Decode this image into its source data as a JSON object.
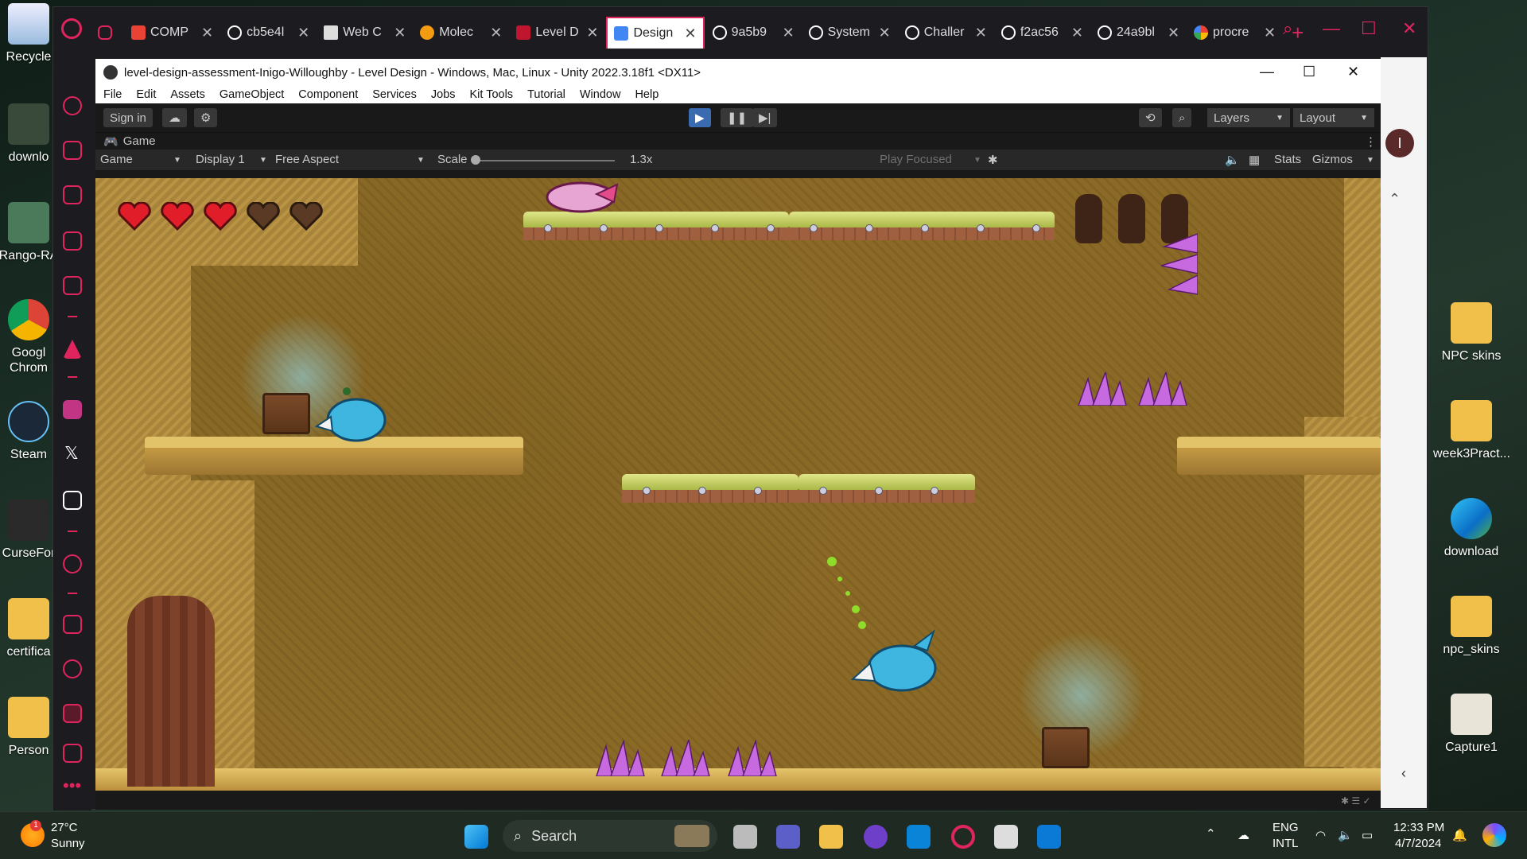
{
  "desktop": {
    "left_icons": [
      "Recycle",
      "downlo",
      "Rango-RA",
      "Googl\nChrom",
      "Steam",
      "CurseFor",
      "certifica",
      "Person"
    ],
    "right_icons": [
      "NPC skins",
      "week3Pract...",
      "download",
      "npc_skins",
      "Capture1"
    ]
  },
  "browser": {
    "tabs": [
      {
        "label": "",
        "icon": "gamepad-icon"
      },
      {
        "label": "COMP",
        "icon": "gmail-icon"
      },
      {
        "label": "cb5e4l",
        "icon": "openai-icon"
      },
      {
        "label": "Web C",
        "icon": "book-icon"
      },
      {
        "label": "Molec",
        "icon": "molecule-icon"
      },
      {
        "label": "Level D",
        "icon": "shield-icon"
      },
      {
        "label": "Design",
        "icon": "docs-icon"
      },
      {
        "label": "9a5b9",
        "icon": "openai-icon"
      },
      {
        "label": "System",
        "icon": "openai-icon"
      },
      {
        "label": "Challer",
        "icon": "openai-icon"
      },
      {
        "label": "f2ac56",
        "icon": "openai-icon"
      },
      {
        "label": "24a9bl",
        "icon": "openai-icon"
      },
      {
        "label": "procre",
        "icon": "google-icon"
      }
    ],
    "active_tab": 6,
    "profile_initial": "I",
    "accent": "#e0245e"
  },
  "unity": {
    "title": "level-design-assessment-Inigo-Willoughby - Level Design - Windows, Mac, Linux - Unity 2022.3.18f1 <DX11>",
    "menu": [
      "File",
      "Edit",
      "Assets",
      "GameObject",
      "Component",
      "Services",
      "Jobs",
      "Kit Tools",
      "Tutorial",
      "Window",
      "Help"
    ],
    "toolbar": {
      "sign_in": "Sign in",
      "layers": "Layers",
      "layout": "Layout"
    },
    "game_tab": "Game",
    "game_bar": {
      "view": "Game",
      "display": "Display 1",
      "aspect": "Free Aspect",
      "scale_label": "Scale",
      "scale_value": "1.3x",
      "play_focused": "Play Focused",
      "stats": "Stats",
      "gizmos": "Gizmos"
    },
    "game": {
      "hearts_full": 3,
      "hearts_empty": 2
    }
  },
  "taskbar": {
    "weather_temp": "27°C",
    "weather_cond": "Sunny",
    "search": "Search",
    "lang_top": "ENG",
    "lang_bottom": "INTL",
    "time": "12:33 PM",
    "date": "4/7/2024"
  }
}
